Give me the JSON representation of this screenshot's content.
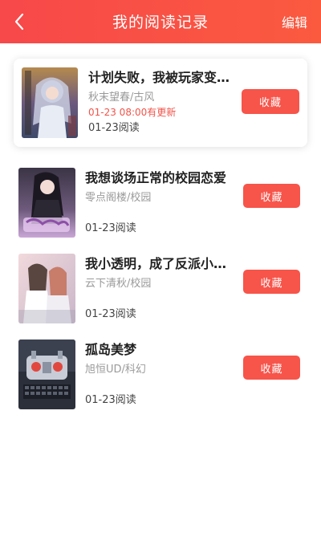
{
  "header": {
    "back_icon": "chevron-left-icon",
    "title": "我的阅读记录",
    "edit_label": "编辑",
    "gradient_colors": [
      "#f7484a",
      "#fb5a3f"
    ]
  },
  "records": [
    {
      "title": "计划失败，我被玩家变…",
      "author_genre": "秋末望春/古风",
      "update_note": "01-23 08:00有更新",
      "read_date": "01-23阅读",
      "button_label": "收藏"
    },
    {
      "title": "我想谈场正常的校园恋爱",
      "author_genre": "零点阁楼/校园",
      "read_date": "01-23阅读",
      "button_label": "收藏"
    },
    {
      "title": "我小透明，成了反派小姐…",
      "author_genre": "云下清秋/校园",
      "read_date": "01-23阅读",
      "button_label": "收藏"
    },
    {
      "title": "孤岛美梦",
      "author_genre": "旭恒UD/科幻",
      "read_date": "01-23阅读",
      "button_label": "收藏"
    }
  ],
  "colors": {
    "accent": "#f7544a",
    "update_text": "#f0544a",
    "muted_text": "#9a9a9a"
  }
}
